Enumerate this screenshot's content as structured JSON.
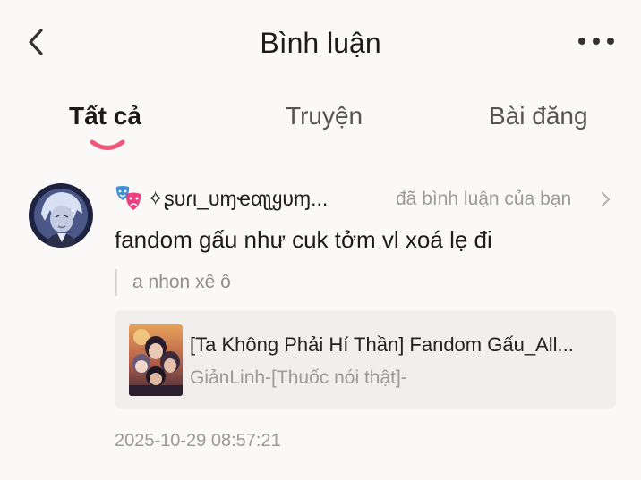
{
  "header": {
    "title": "Bình luận",
    "back_icon": "chevron-left-icon",
    "more_icon": "more-horizontal-icon"
  },
  "tabs": [
    {
      "label": "Tất cả",
      "active": true
    },
    {
      "label": "Truyện",
      "active": false
    },
    {
      "label": "Bài đăng",
      "active": false
    }
  ],
  "comment": {
    "username": "✧ʂυɾι_υɱҽαʅʅყυɱ...",
    "badge_icon": "theater-masks-icon",
    "action_text": "đã bình luận của bạn",
    "text": "fandom gấu như cuk tởm vl xoá lẹ đi",
    "quoted_text": "a nhon xê ô",
    "story": {
      "title": "[Ta Không Phải Hí Thần] Fandom Gấu_All...",
      "author": "GiảnLinh-[Thuốc nói thật]-"
    },
    "timestamp": "2025-10-29 08:57:21"
  },
  "colors": {
    "background": "#fbf9f8",
    "accent": "#f0577a",
    "card_background": "#f1efee",
    "muted_text": "#9a9a9a"
  }
}
